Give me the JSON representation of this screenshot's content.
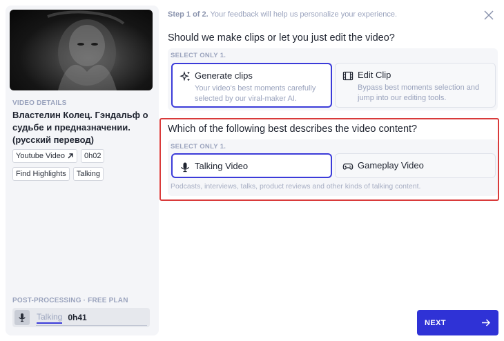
{
  "sidebar": {
    "video_details_label": "VIDEO DETAILS",
    "video_title": "Властелин Колец. Гэндальф о судьбе и предназначении. (русский перевод)",
    "tags_row1": [
      "Youtube Video",
      "0h02"
    ],
    "tags_row2": [
      "Find Highlights",
      "Talking"
    ],
    "post_processing_label": "POST-PROCESSING · FREE PLAN",
    "post_processing_mode": "Talking",
    "post_processing_time": "0h41"
  },
  "header": {
    "step_bold": "Step 1 of 2.",
    "step_text": " Your feedback will help us personalize your experience."
  },
  "question1": {
    "title": "Should we make clips or let you just edit the video?",
    "select_label": "SELECT ONLY 1.",
    "options": [
      {
        "title": "Generate clips",
        "desc": "Your video's best moments carefully selected by our viral-maker AI.",
        "icon": "sparkles-icon",
        "selected": true
      },
      {
        "title": "Edit Clip",
        "desc": "Bypass best moments selection and jump into our editing tools.",
        "icon": "film-icon",
        "selected": false
      }
    ]
  },
  "question2": {
    "title": "Which of the following best describes the video content?",
    "select_label": "SELECT ONLY 1.",
    "options": [
      {
        "title": "Talking Video",
        "icon": "microphone-icon",
        "selected": true
      },
      {
        "title": "Gameplay Video",
        "icon": "gamepad-icon",
        "selected": false
      }
    ],
    "hint": "Podcasts, interviews, talks, product reviews and other kinds of talking content."
  },
  "footer": {
    "next_label": "NEXT"
  },
  "colors": {
    "accent": "#2f32d6",
    "selected_border": "#3b3bd9",
    "highlight_border": "#d93a3a",
    "muted_text": "#9aa3bd"
  }
}
